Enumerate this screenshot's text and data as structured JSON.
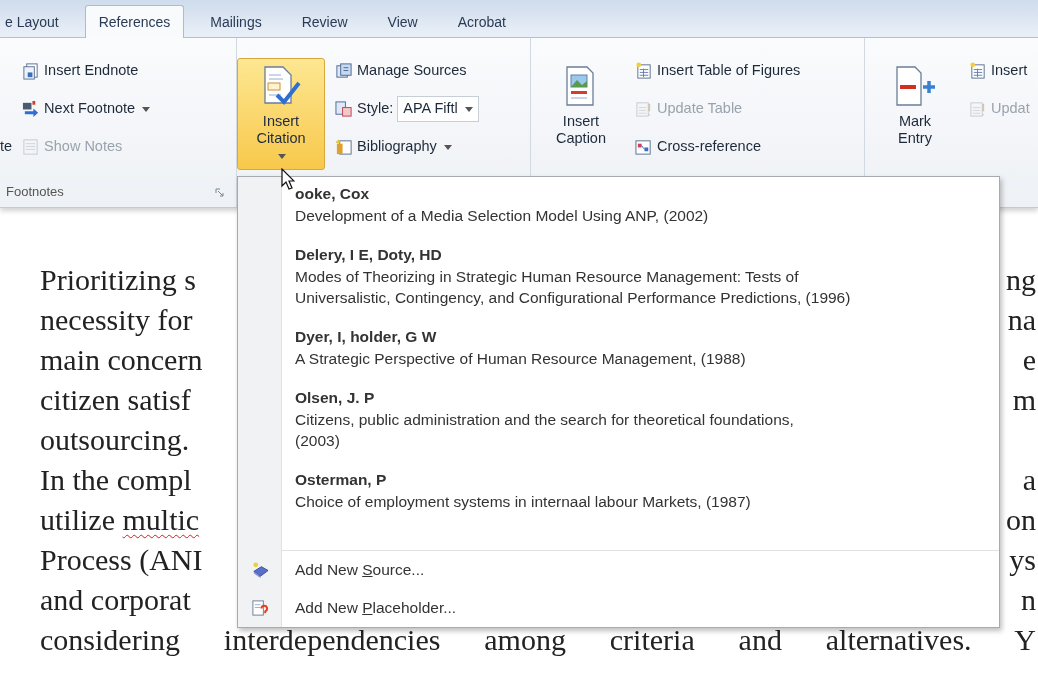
{
  "tabs": [
    {
      "label": "e Layout",
      "selected": false
    },
    {
      "label": "References",
      "selected": true
    },
    {
      "label": "Mailings",
      "selected": false
    },
    {
      "label": "Review",
      "selected": false
    },
    {
      "label": "View",
      "selected": false
    },
    {
      "label": "Acrobat",
      "selected": false
    }
  ],
  "ribbon": {
    "groups": [
      {
        "label": "Footnotes",
        "launcher": true,
        "clipped_text": "te",
        "items": [
          {
            "kind": "button",
            "label": "Insert Endnote",
            "dropdown": false,
            "disabled": false
          },
          {
            "kind": "button",
            "label": "Next Footnote",
            "dropdown": true,
            "disabled": false
          },
          {
            "kind": "button",
            "label": "Show Notes",
            "dropdown": false,
            "disabled": true
          }
        ]
      },
      {
        "big_buttons": [
          {
            "label": "Insert Citation",
            "dropdown": true,
            "pressed": true
          }
        ],
        "items": [
          {
            "kind": "button",
            "label": "Manage Sources",
            "dropdown": false,
            "disabled": false
          },
          {
            "kind": "select",
            "label": "Style:",
            "value": "APA Fiftl"
          },
          {
            "kind": "button",
            "label": "Bibliography",
            "dropdown": true,
            "disabled": false
          }
        ]
      },
      {
        "big_buttons": [
          {
            "label": "Insert Caption",
            "dropdown": false,
            "pressed": false
          }
        ],
        "items": [
          {
            "kind": "button",
            "label": "Insert Table of Figures",
            "dropdown": false,
            "disabled": false
          },
          {
            "kind": "button",
            "label": "Update Table",
            "dropdown": false,
            "disabled": true
          },
          {
            "kind": "button",
            "label": "Cross-reference",
            "dropdown": false,
            "disabled": false
          }
        ]
      },
      {
        "big_buttons": [
          {
            "label": "Mark Entry",
            "dropdown": false,
            "pressed": false
          }
        ],
        "items": [
          {
            "kind": "button",
            "label": "Insert",
            "dropdown": false,
            "disabled": false
          },
          {
            "kind": "button",
            "label": "Updat",
            "dropdown": false,
            "disabled": true
          }
        ]
      }
    ]
  },
  "citation_menu": {
    "sources": [
      {
        "author": "ooke, Cox",
        "title_lines": [
          "Development of a Media Selection Model Using ANP, (2002)"
        ]
      },
      {
        "author": "Delery, I E,  Doty, HD",
        "title_lines": [
          "Modes of Theorizing in Strategic Human Resource Management: Tests of",
          "Universalistic, Contingency, and Configurational Performance Predictions, (1996)"
        ]
      },
      {
        "author": "Dyer, I,  holder, G W",
        "title_lines": [
          "A Strategic Perspective of Human Resource Management, (1988)"
        ]
      },
      {
        "author": "Olsen, J. P",
        "title_lines": [
          "Citizens, public administration and the search for theoretical foundations,",
          "(2003)"
        ]
      },
      {
        "author": "Osterman, P",
        "title_lines": [
          "Choice of employment systems in internaal labour Markets, (1987)"
        ]
      }
    ],
    "actions": [
      {
        "before": "Add New ",
        "access_key": "S",
        "after": "ource..."
      },
      {
        "before": "Add New ",
        "access_key": "P",
        "after": "laceholder..."
      }
    ]
  },
  "document": {
    "lines": [
      {
        "left": "Prioritizing s",
        "right": "ng"
      },
      {
        "left": "necessity for",
        "right": "na"
      },
      {
        "left": "main concern",
        "right": "e"
      },
      {
        "left": "citizen satisf",
        "right": "m"
      },
      {
        "left": "outsourcing."
      },
      {
        "left": "In the compl",
        "right": "a"
      },
      {
        "left": "utilize ",
        "misspelled": "multic",
        "right": "on"
      },
      {
        "left": "Process (ANI",
        "right": "ys"
      },
      {
        "left": "and corporat",
        "right": "n"
      },
      {
        "left": "considering interdependencies among criteria and alternatives. Y"
      }
    ]
  }
}
